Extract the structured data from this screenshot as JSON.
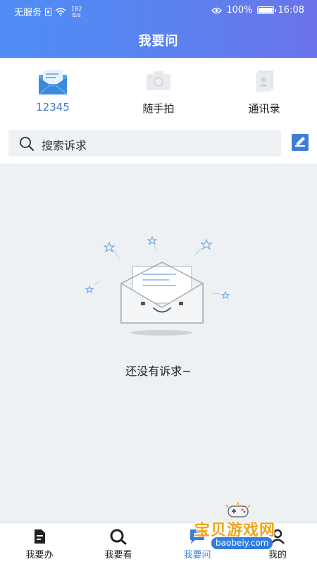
{
  "status_bar": {
    "carrier": "无服务",
    "net_speed_value": "182",
    "net_speed_unit": "B/s",
    "battery_percent": "100%",
    "time": "16:08"
  },
  "header": {
    "title": "我要问"
  },
  "quick_entries": [
    {
      "label": "12345",
      "icon": "mail-icon",
      "active": true
    },
    {
      "label": "随手拍",
      "icon": "camera-icon",
      "active": false
    },
    {
      "label": "通讯录",
      "icon": "contacts-icon",
      "active": false
    }
  ],
  "search": {
    "placeholder": "搜索诉求"
  },
  "empty_state": {
    "message": "还没有诉求~",
    "illustration": "empty-mailbox-icon"
  },
  "bottom_nav": [
    {
      "label": "我要办",
      "icon": "document-icon",
      "active": false
    },
    {
      "label": "我要看",
      "icon": "magnifier-icon",
      "active": false
    },
    {
      "label": "我要问",
      "icon": "chat-icon",
      "active": true
    },
    {
      "label": "我的",
      "icon": "person-icon",
      "active": false
    }
  ],
  "watermark": {
    "text": "宝贝游戏网",
    "url": "baobeiy.com"
  },
  "colors": {
    "header_gradient_start": "#4f8df5",
    "header_gradient_end": "#6a74e8",
    "accent": "#3f7ed8",
    "content_bg": "#eef1f4"
  }
}
